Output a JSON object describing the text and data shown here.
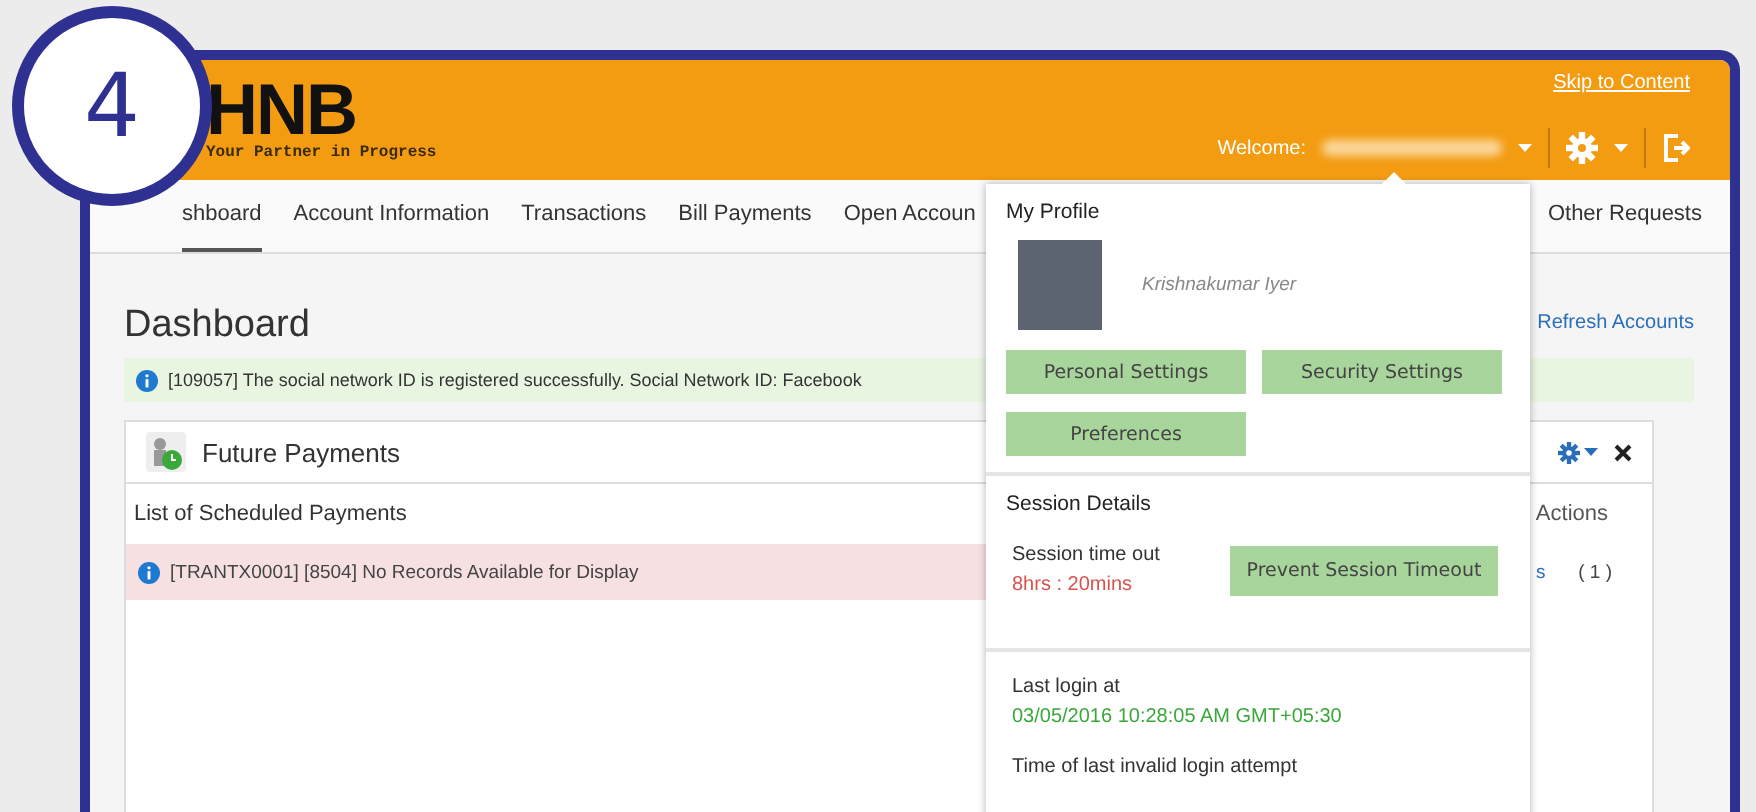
{
  "step_badge": {
    "number": "4"
  },
  "header": {
    "logo": "HNB",
    "slogan": "Your Partner in Progress",
    "skip_link": "Skip to Content",
    "welcome": "Welcome:"
  },
  "nav": {
    "tabs": [
      {
        "label": "shboard",
        "selected": true
      },
      {
        "label": "Account Information",
        "selected": false
      },
      {
        "label": "Transactions",
        "selected": false
      },
      {
        "label": "Bill Payments",
        "selected": false
      },
      {
        "label": "Open Accoun",
        "selected": false
      },
      {
        "label": "Other Requests",
        "selected": false
      }
    ]
  },
  "page": {
    "title": "Dashboard",
    "refresh_link": "Refresh Accounts",
    "notice": "[109057] The social network ID is registered successfully. Social Network ID: Facebook"
  },
  "panel": {
    "title": "Future Payments",
    "subtitle": "List of Scheduled Payments",
    "actions_column": "Actions",
    "error": "[TRANTX0001] [8504] No Records Available for Display",
    "row_link": "s",
    "row_count": "( 1 )"
  },
  "profile_menu": {
    "title": "My Profile",
    "name": "Krishnakumar Iyer",
    "buttons": [
      "Personal Settings",
      "Security Settings",
      "Preferences"
    ],
    "session_title": "Session Details",
    "timeout_label": "Session time out",
    "timeout_value": "8hrs : 20mins",
    "prevent_button": "Prevent Session Timeout",
    "last_login_label": "Last login at",
    "last_login_value": "03/05/2016 10:28:05 AM GMT+05:30",
    "invalid_login_label": "Time of last invalid login attempt"
  }
}
